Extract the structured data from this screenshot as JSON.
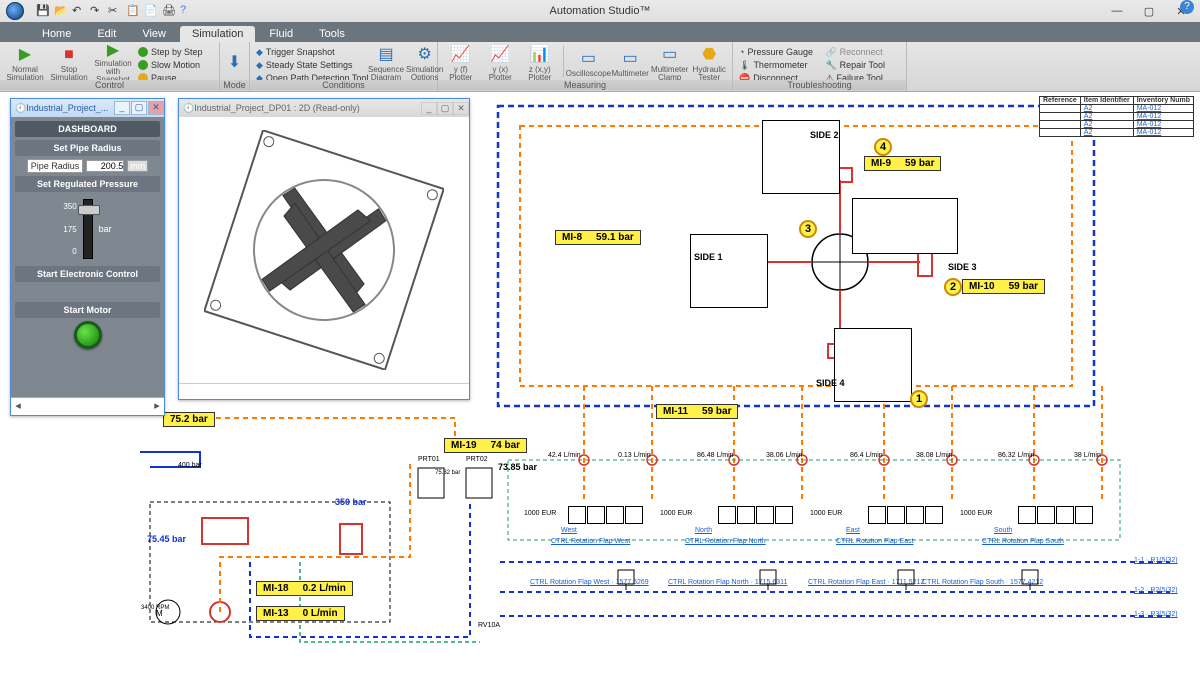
{
  "app": {
    "title": "Automation Studio™"
  },
  "menu_tabs": [
    "Home",
    "Edit",
    "View",
    "Simulation",
    "Fluid",
    "Tools"
  ],
  "active_tab": "Simulation",
  "ribbon": {
    "control": {
      "label": "Control",
      "normal": "Normal Simulation",
      "stop": "Stop Simulation",
      "snap": "Simulation with Snapshot",
      "step": "Step by Step",
      "slow": "Slow Motion",
      "pause": "Pause"
    },
    "mode": {
      "label": "Mode"
    },
    "conditions": {
      "label": "Conditions",
      "trigger": "Trigger Snapshot",
      "steady": "Steady State Settings",
      "open": "Open Path Detection Tool",
      "seq": "Sequence Diagram",
      "sim": "Simulation Options"
    },
    "measuring": {
      "label": "Measuring",
      "yft": "y (f) Plotter",
      "yxt": "y (x) Plotter",
      "zxy": "z (x,y) Plotter",
      "osc": "Oscilloscope",
      "multi": "Multimeter",
      "clamp": "Multimeter Clamp",
      "hyd": "Hydraulic Tester"
    },
    "troubleshoot": {
      "label": "Troubleshooting",
      "gauge": "Pressure Gauge",
      "therm": "Thermometer",
      "disc": "Disconnect",
      "recon": "Reconnect",
      "repair": "Repair Tool",
      "fail": "Failure Tool"
    }
  },
  "dashboard_win": {
    "title": "Industrial_Project_..."
  },
  "viewer_win": {
    "title": "Industrial_Project_DP01 : 2D (Read-only)"
  },
  "dashboard": {
    "heading": "DASHBOARD",
    "set_radius": "Set Pipe Radius",
    "radius_label": "Pipe Radius",
    "radius_value": "200.5",
    "radius_unit": "mm",
    "set_pressure": "Set Regulated Pressure",
    "scale": [
      "350",
      "175",
      "0"
    ],
    "pressure_unit": "bar",
    "start_elec": "Start Electronic Control",
    "start_motor": "Start Motor"
  },
  "readouts": {
    "mi8": {
      "id": "MI-8",
      "val": "59.1 bar"
    },
    "mi9": {
      "id": "MI-9",
      "val": "59 bar"
    },
    "mi10": {
      "id": "MI-10",
      "val": "59 bar"
    },
    "mi11": {
      "id": "MI-11",
      "val": "59 bar"
    },
    "mi13": {
      "id": "MI-13",
      "val": "0 L/min"
    },
    "mi18": {
      "id": "MI-18",
      "val": "0.2 L/min"
    },
    "mi19": {
      "id": "MI-19",
      "val": "74 bar"
    },
    "r752": "75.2 bar",
    "r7385": "73.85 bar",
    "r350": "350 bar",
    "r7545": "75.45 bar"
  },
  "sides": {
    "s1": "SIDE 1",
    "s2": "SIDE 2",
    "s3": "SIDE 3",
    "s4": "SIDE 4"
  },
  "flows": {
    "f1a": "42.4 L/min",
    "f1b": "0.13 L/min",
    "f2a": "86.48 L/min",
    "f2b": "38.06 L/min",
    "f3a": "86.4 L/min",
    "f3b": "38.08 L/min",
    "f4a": "86.32 L/min",
    "f4b": "38 L/min"
  },
  "blocks": {
    "eur": "1000 EUR",
    "west": "West",
    "north": "North",
    "east": "East",
    "south": "South",
    "ctrl_w": "CTRL Rotation Flap West",
    "ctrl_n": "CTRL Rotation Flap North",
    "ctrl_e": "CTRL Rotation Flap East",
    "ctrl_s": "CTRL Rotation Flap South",
    "cmd_w": "CTRL Rotation Flap West · 1577.5269",
    "cmd_n": "CTRL Rotation Flap North · 1715.6311",
    "cmd_e": "CTRL Rotation Flap East · 1711.5212",
    "cmd_s": "CTRL Rotation Flap South · 1577.4212"
  },
  "ports": {
    "r1": "1-1 · R1(5/32)",
    "r2": "1-2 · R2(5/32)",
    "r3": "1-3 · R3(5/32)"
  },
  "reftable": {
    "headers": [
      "Reference",
      "Item Identifier",
      "Inventory Numb"
    ],
    "rows": [
      [
        "",
        "A2",
        "MA-012"
      ],
      [
        "",
        "A2",
        "MA-012"
      ],
      [
        "",
        "A2",
        "MA-012"
      ],
      [
        "",
        "A2",
        "MA-012"
      ]
    ]
  },
  "pump": {
    "p400": "400 bar",
    "prt1": "PRT01",
    "prt2": "PRT02",
    "p7532": "75.32 bar",
    "rpm": "3400 RPM",
    "rv": "RV10A"
  }
}
